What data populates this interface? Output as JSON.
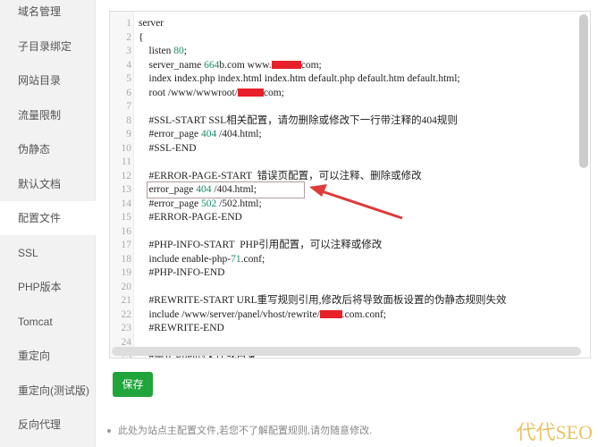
{
  "sidebar": {
    "items": [
      "域名管理",
      "子目录绑定",
      "网站目录",
      "流量限制",
      "伪静态",
      "默认文档",
      "配置文件",
      "SSL",
      "PHP版本",
      "Tomcat",
      "重定向",
      "重定向(测试版)",
      "反向代理"
    ],
    "active": "配置文件"
  },
  "editor": {
    "lines": [
      [
        [
          "server",
          ""
        ]
      ],
      [
        [
          "{",
          ""
        ]
      ],
      [
        [
          "    listen ",
          ""
        ],
        [
          "80",
          "num"
        ],
        [
          ";",
          ""
        ]
      ],
      [
        [
          "    server_name ",
          ""
        ],
        [
          "664",
          "num"
        ],
        [
          "b.com www.",
          ""
        ],
        [
          "",
          "red:33"
        ],
        [
          "com;",
          ""
        ]
      ],
      [
        [
          "    index index.php index.html index.htm default.php default.htm default.html;",
          ""
        ]
      ],
      [
        [
          "    root /www/wwwroot/",
          ""
        ],
        [
          "",
          "red:29"
        ],
        [
          "com;",
          ""
        ]
      ],
      [
        [
          "",
          ""
        ]
      ],
      [
        [
          "    #SSL-START SSL相关配置，请勿删除或修改下一行带注释的404规则",
          ""
        ]
      ],
      [
        [
          "    #error_page ",
          ""
        ],
        [
          "404",
          "num"
        ],
        [
          " /404.html;",
          ""
        ]
      ],
      [
        [
          "    #SSL-END",
          ""
        ]
      ],
      [
        [
          "",
          ""
        ]
      ],
      [
        [
          "    #ERROR-PAGE-START  错误页配置，可以注释、删除或修改",
          ""
        ]
      ],
      [
        [
          "    error_page ",
          ""
        ],
        [
          "404",
          "num"
        ],
        [
          " /404.html;",
          ""
        ]
      ],
      [
        [
          "    #error_page ",
          ""
        ],
        [
          "502",
          "num"
        ],
        [
          " /502.html;",
          ""
        ]
      ],
      [
        [
          "    #ERROR-PAGE-END",
          ""
        ]
      ],
      [
        [
          "",
          ""
        ]
      ],
      [
        [
          "    #PHP-INFO-START  PHP引用配置，可以注释或修改",
          ""
        ]
      ],
      [
        [
          "    include enable-php-",
          ""
        ],
        [
          "71",
          "num"
        ],
        [
          ".conf;",
          ""
        ]
      ],
      [
        [
          "    #PHP-INFO-END",
          ""
        ]
      ],
      [
        [
          "",
          ""
        ]
      ],
      [
        [
          "    #REWRITE-START URL重写规则引用,修改后将导致面板设置的伪静态规则失效",
          ""
        ]
      ],
      [
        [
          "    include /www/server/panel/vhost/rewrite/",
          ""
        ],
        [
          "",
          "red:25"
        ],
        [
          ".com.conf;",
          ""
        ]
      ],
      [
        [
          "    #REWRITE-END",
          ""
        ]
      ],
      [
        [
          "",
          ""
        ]
      ],
      [
        [
          "    #禁止访问的文件或目录",
          ""
        ]
      ]
    ]
  },
  "save_label": "保存",
  "note": "此处为站点主配置文件,若您不了解配置规则,请勿随意修改.",
  "watermark": "代代SEO",
  "colors": {
    "accent": "#20a53a",
    "number": "#198c6c",
    "arrow": "#e03a3a"
  }
}
